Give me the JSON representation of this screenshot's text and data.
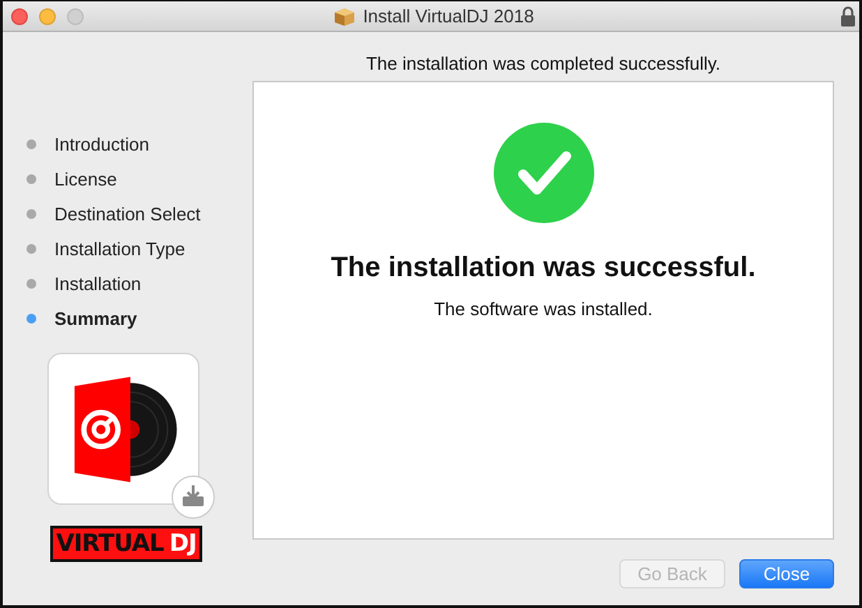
{
  "window": {
    "title": "Install VirtualDJ 2018"
  },
  "header": "The installation was completed successfully.",
  "steps": [
    {
      "label": "Introduction",
      "selected": false
    },
    {
      "label": "License",
      "selected": false
    },
    {
      "label": "Destination Select",
      "selected": false
    },
    {
      "label": "Installation Type",
      "selected": false
    },
    {
      "label": "Installation",
      "selected": false
    },
    {
      "label": "Summary",
      "selected": true
    }
  ],
  "logo": {
    "part_1": "VIRTUAL",
    "part_2": "DJ"
  },
  "content": {
    "heading": "The installation was successful.",
    "message": "The software was installed."
  },
  "buttons": [
    {
      "label": "Go Back",
      "disabled": true,
      "default": false
    },
    {
      "label": "Close",
      "disabled": false,
      "default": true
    }
  ]
}
